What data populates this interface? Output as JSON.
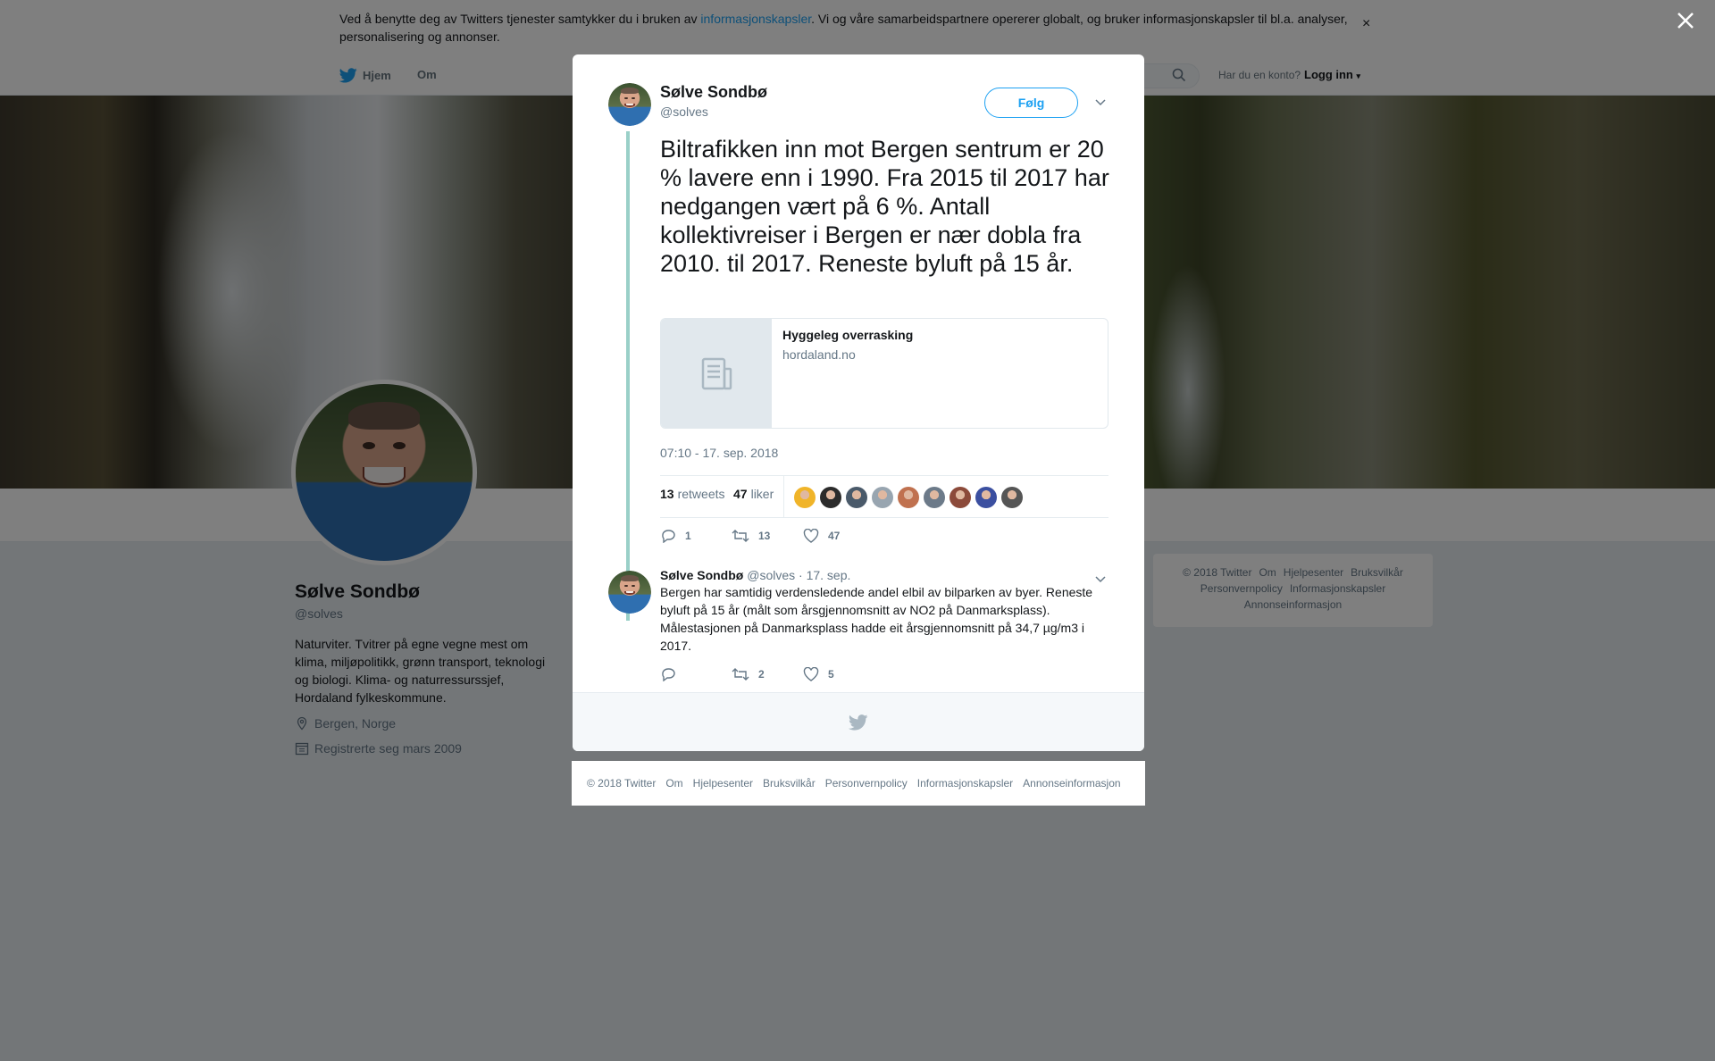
{
  "cookie_banner": {
    "text_before": "Ved å benytte deg av Twitters tjenester samtykker du i bruken av ",
    "link": "informasjonskapsler",
    "text_after": ". Vi og våre samarbeidspartnere opererer globalt, og bruker informasjonskapsler til bl.a. analyser, personalisering og annonser.",
    "close": "×"
  },
  "topnav": {
    "home": "Hjem",
    "about": "Om",
    "account_prompt": "Har du en konto?",
    "login": "Logg inn"
  },
  "profile": {
    "name": "Sølve Sondbø",
    "handle": "@solves",
    "bio": "Naturviter. Tvitrer på egne vegne mest om klima, miljøpolitikk, grønn transport, teknologi og biologi. Klima- og naturressurssjef, Hordaland fylkeskommune.",
    "location": "Bergen, Norge",
    "joined": "Registrerte seg mars 2009"
  },
  "tweet": {
    "author_name": "Sølve Sondbø",
    "author_handle": "@solves",
    "follow_label": "Følg",
    "text": "Biltrafikken inn mot Bergen sentrum er 20 % lavere enn i 1990. Fra 2015 til 2017 har nedgangen vært på 6 %. Antall kollektivreiser i Bergen er nær dobla fra 2010. til 2017. Reneste byluft på 15 år.",
    "card_title": "Hyggeleg overrasking",
    "card_domain": "hordaland.no",
    "timestamp": "07:10 - 17. sep. 2018",
    "retweets_count": "13",
    "retweets_label": "retweets",
    "likes_count": "47",
    "likes_label": "liker",
    "liker_colors": [
      "#f0b429",
      "#2b2b2b",
      "#4a5a6a",
      "#98a5b0",
      "#c0714f",
      "#6c7a89",
      "#8c4a3a",
      "#3b4fa0",
      "#555555"
    ],
    "actions": {
      "reply": "1",
      "retweet": "13",
      "like": "47"
    }
  },
  "reply": {
    "author_name": "Sølve Sondbø",
    "author_handle": "@solves",
    "date": "· 17. sep.",
    "text": "Bergen har samtidig verdensledende andel elbil av bilparken av byer. Reneste byluft på 15 år (målt som årsgjennomsnitt av NO2 på Danmarksplass). Målestasjonen på Danmarksplass hadde eit årsgjennomsnitt på 34,7 µg/m3 i 2017.",
    "actions": {
      "reply": "",
      "retweet": "2",
      "like": "5"
    }
  },
  "footer": {
    "copyright": "© 2018 Twitter",
    "about": "Om",
    "help": "Hjelpesenter",
    "terms": "Bruksvilkår",
    "privacy": "Personvernpolicy",
    "cookies": "Informasjonskapsler",
    "ads": "Annonseinformasjon"
  },
  "colors": {
    "twitter_blue": "#1da1f2",
    "thread_line": "#9ad0c8"
  }
}
